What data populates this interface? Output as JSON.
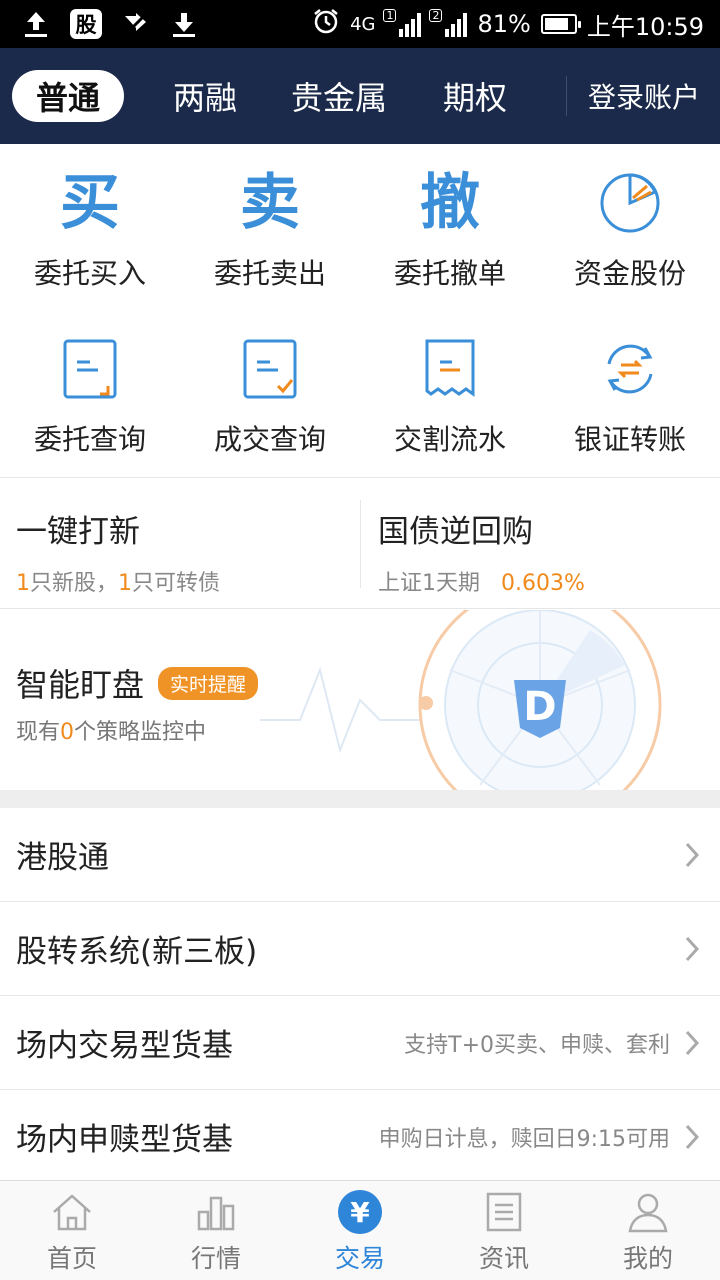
{
  "status_bar": {
    "gu_icon_label": "股",
    "network": "4G",
    "sim1": "1",
    "sim2": "2",
    "battery": "81%",
    "time": "上午10:59"
  },
  "top_nav": {
    "tabs": [
      {
        "label": "普通",
        "active": true
      },
      {
        "label": "两融",
        "active": false
      },
      {
        "label": "贵金属",
        "active": false
      },
      {
        "label": "期权",
        "active": false
      }
    ],
    "login": "登录账户"
  },
  "grid": {
    "items": [
      {
        "label": "委托买入",
        "icon": "buy-icon",
        "glyph": "买"
      },
      {
        "label": "委托卖出",
        "icon": "sell-icon",
        "glyph": "卖"
      },
      {
        "label": "委托撤单",
        "icon": "cancel-icon",
        "glyph": "撤"
      },
      {
        "label": "资金股份",
        "icon": "pie-chart-icon"
      },
      {
        "label": "委托查询",
        "icon": "order-query-icon"
      },
      {
        "label": "成交查询",
        "icon": "deal-query-icon"
      },
      {
        "label": "交割流水",
        "icon": "receipt-icon"
      },
      {
        "label": "银证转账",
        "icon": "transfer-icon"
      }
    ]
  },
  "ipo": {
    "title": "一键打新",
    "new_stock_count": "1",
    "new_stock_text": "只新股，",
    "bond_count": "1",
    "bond_text": "只可转债"
  },
  "repo": {
    "title": "国债逆回购",
    "term": "上证1天期",
    "rate": "0.603%"
  },
  "smart": {
    "title": "智能盯盘",
    "badge": "实时提醒",
    "sub_prefix": "现有",
    "count": "0",
    "sub_suffix": "个策略监控中",
    "logo_letter": "D"
  },
  "list": [
    {
      "label": "港股通",
      "hint": ""
    },
    {
      "label": "股转系统(新三板)",
      "hint": ""
    },
    {
      "label": "场内交易型货基",
      "hint": "支持T+0买卖、申赎、套利"
    },
    {
      "label": "场内申赎型货基",
      "hint": "申购日计息，赎回日9:15可用"
    }
  ],
  "bottom_nav": [
    {
      "label": "首页",
      "icon": "home-icon",
      "active": false
    },
    {
      "label": "行情",
      "icon": "market-icon",
      "active": false
    },
    {
      "label": "交易",
      "icon": "yen-icon",
      "glyph": "¥",
      "active": true
    },
    {
      "label": "资讯",
      "icon": "news-icon",
      "active": false
    },
    {
      "label": "我的",
      "icon": "profile-icon",
      "active": false
    }
  ],
  "colors": {
    "nav_bg": "#1b2a4a",
    "accent_blue": "#2f86d9",
    "accent_orange": "#f08a1c"
  }
}
